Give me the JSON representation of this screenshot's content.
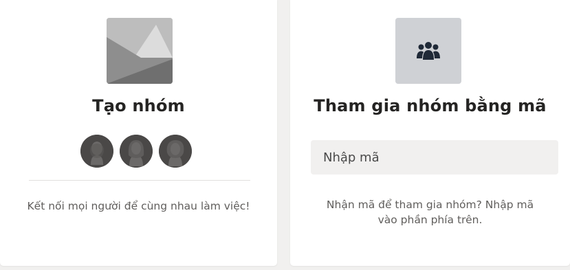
{
  "create_card": {
    "title": "Tạo nhóm",
    "subtitle": "Kết nối mọi người để cùng nhau làm việc!",
    "thumbnail_icon": "image-placeholder-icon",
    "avatars": [
      {
        "icon": "person-avatar-icon"
      },
      {
        "icon": "person-avatar-icon"
      },
      {
        "icon": "person-avatar-icon"
      }
    ]
  },
  "join_card": {
    "title": "Tham gia nhóm bằng mã",
    "input_placeholder": "Nhập mã",
    "input_value": "",
    "description": "Nhận mã để tham gia nhóm? Nhập mã vào phần phía trên.",
    "tile_icon": "team-people-icon"
  },
  "colors": {
    "background": "#f1f0ef",
    "card": "#ffffff",
    "title_text": "#252423",
    "muted_text": "#605e5c",
    "avatar": "#4a4847",
    "team_tile": "#cfd1d5",
    "team_icon": "#1f2937"
  }
}
